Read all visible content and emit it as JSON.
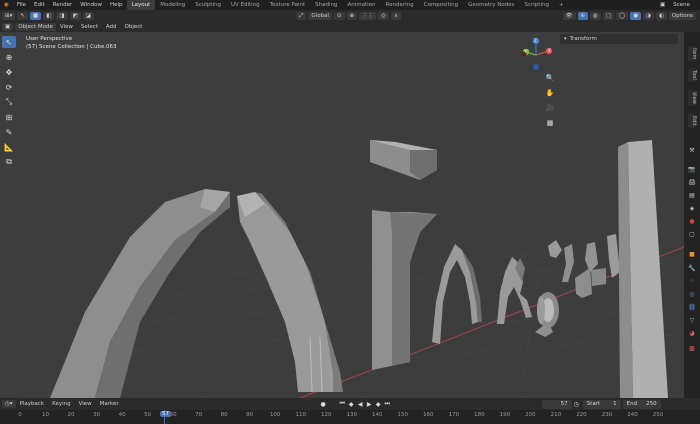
{
  "menubar": {
    "items": [
      "File",
      "Edit",
      "Render",
      "Window",
      "Help"
    ],
    "workspaces": [
      "Layout",
      "Modeling",
      "Sculpting",
      "UV Editing",
      "Texture Paint",
      "Shading",
      "Animation",
      "Rendering",
      "Compositing",
      "Geometry Nodes",
      "Scripting"
    ],
    "active_workspace": "Layout",
    "add_workspace": "+",
    "scene_label": "Scene"
  },
  "header": {
    "mode": "Object Mode",
    "menus": [
      "View",
      "Select",
      "Add",
      "Object"
    ],
    "orientation": "Global",
    "options": "Options"
  },
  "viewport": {
    "perspective": "User Perspective",
    "collection": "(57) Scene Collection | Cube.063",
    "gizmo": {
      "x": "X",
      "y": "Y",
      "z": "Z"
    }
  },
  "sidebar": {
    "panel_title": "Transform",
    "tabs": [
      "Item",
      "Tool",
      "View",
      "Edit"
    ]
  },
  "timeline": {
    "menus": [
      "Playback",
      "Keying",
      "View",
      "Marker"
    ],
    "current_frame": "57",
    "start_label": "Start",
    "start_value": "1",
    "end_label": "End",
    "end_value": "250",
    "ticks": [
      "0",
      "10",
      "20",
      "30",
      "40",
      "50",
      "60",
      "70",
      "80",
      "90",
      "100",
      "110",
      "120",
      "130",
      "140",
      "150",
      "160",
      "170",
      "180",
      "190",
      "200",
      "210",
      "220",
      "230",
      "240",
      "250"
    ],
    "playhead": "57"
  },
  "colors": {
    "accent": "#4772b3",
    "viewport_bg": "#3d3d3d",
    "x_axis": "#e0525f",
    "y_axis": "#7fc43b",
    "z_axis": "#3f83d6"
  }
}
